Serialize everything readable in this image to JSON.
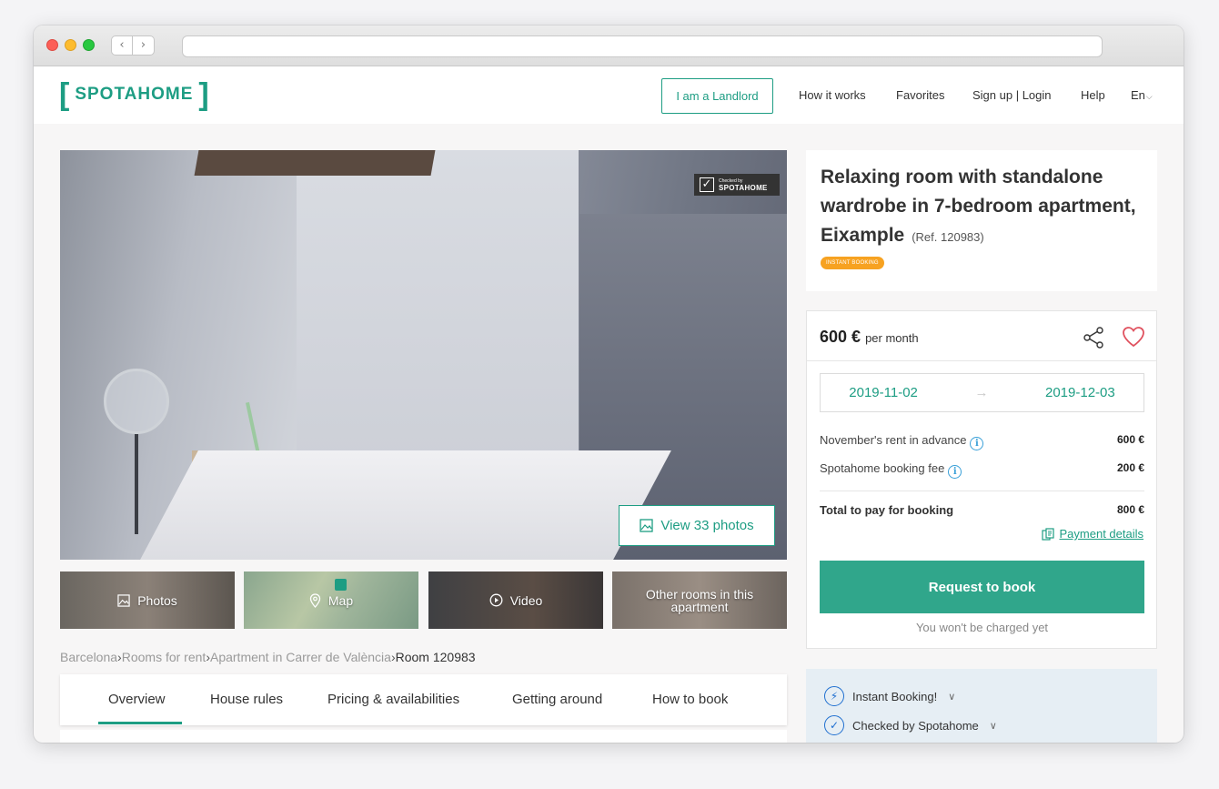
{
  "header": {
    "logo_left_bracket": "[",
    "logo_text": "SPOTAHOME",
    "logo_right_bracket": "]",
    "landlord_button": "I am a Landlord",
    "nav": [
      "How it works",
      "Favorites",
      "Sign up | Login",
      "Help",
      "En"
    ],
    "language_chevron": "⌵"
  },
  "gallery": {
    "checked_badge_small": "Checked by",
    "checked_badge_brand": "SPOTAHOME",
    "view_photos_label": "View 33 photos",
    "thumbnails": [
      "Photos",
      "Map",
      "Video",
      "Other rooms in this apartment"
    ]
  },
  "breadcrumb": {
    "items": [
      "Barcelona",
      "Rooms for rent",
      "Apartment in Carrer de València"
    ],
    "separator": "›",
    "current": "Room 120983"
  },
  "tabs": [
    "Overview",
    "House rules",
    "Pricing & availabilities",
    "Getting around",
    "How to book"
  ],
  "active_tab": "Overview",
  "listing": {
    "title": "Relaxing room with standalone wardrobe in 7-bedroom apartment, Eixample",
    "ref": "(Ref. 120983)",
    "badge": "INSTANT BOOKING"
  },
  "booking": {
    "price": "600 €",
    "price_period": "per month",
    "date_from": "2019-11-02",
    "date_arrow": "→",
    "date_to": "2019-12-03",
    "lines": [
      {
        "label": "November's rent in advance",
        "amount": "600 €"
      },
      {
        "label": "Spotahome booking fee",
        "amount": "200 €"
      }
    ],
    "total_label": "Total to pay for booking",
    "total_amount": "800 €",
    "payment_details": "Payment details",
    "request_button": "Request to book",
    "no_charge_note": "You won't be charged yet"
  },
  "perks": [
    "Instant Booking!",
    "Checked by Spotahome"
  ],
  "colors": {
    "brand": "#1d9d83",
    "button": "#30a68b",
    "badge": "#f7a221",
    "heart": "#e0525f",
    "info": "#3aa0d8"
  }
}
